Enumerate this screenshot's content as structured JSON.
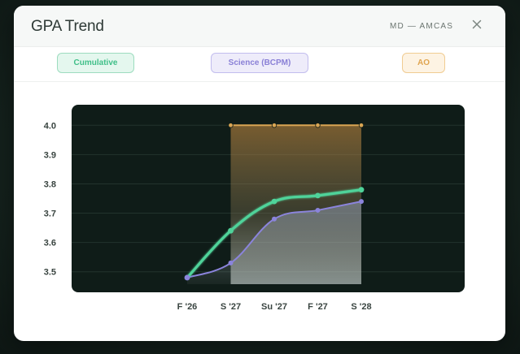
{
  "header": {
    "title": "GPA Trend",
    "context": "MD — AMCAS"
  },
  "legend": {
    "cumulative": "Cumulative",
    "science": "Science (BCPM)",
    "ao": "AO"
  },
  "colors": {
    "cumulative": "#4fd39a",
    "science": "#8b84dc",
    "ao": "#d9a553",
    "plot_bg": "#0f1c18"
  },
  "chart_data": {
    "type": "line",
    "categories": [
      "F '26",
      "S '27",
      "Su '27",
      "F '27",
      "S '28"
    ],
    "y_ticks": [
      "3.5",
      "3.6",
      "3.7",
      "3.8",
      "3.9",
      "4.0"
    ],
    "ylim": [
      3.43,
      4.07
    ],
    "origin_value": 3.48,
    "series": [
      {
        "name": "Cumulative",
        "values": [
          3.48,
          3.64,
          3.74,
          3.76,
          3.78
        ]
      },
      {
        "name": "Science (BCPM)",
        "values": [
          3.48,
          3.53,
          3.68,
          3.71,
          3.74
        ]
      },
      {
        "name": "AO",
        "values": [
          null,
          4.0,
          4.0,
          4.0,
          4.0
        ]
      }
    ],
    "grid": true,
    "legend": "top"
  }
}
